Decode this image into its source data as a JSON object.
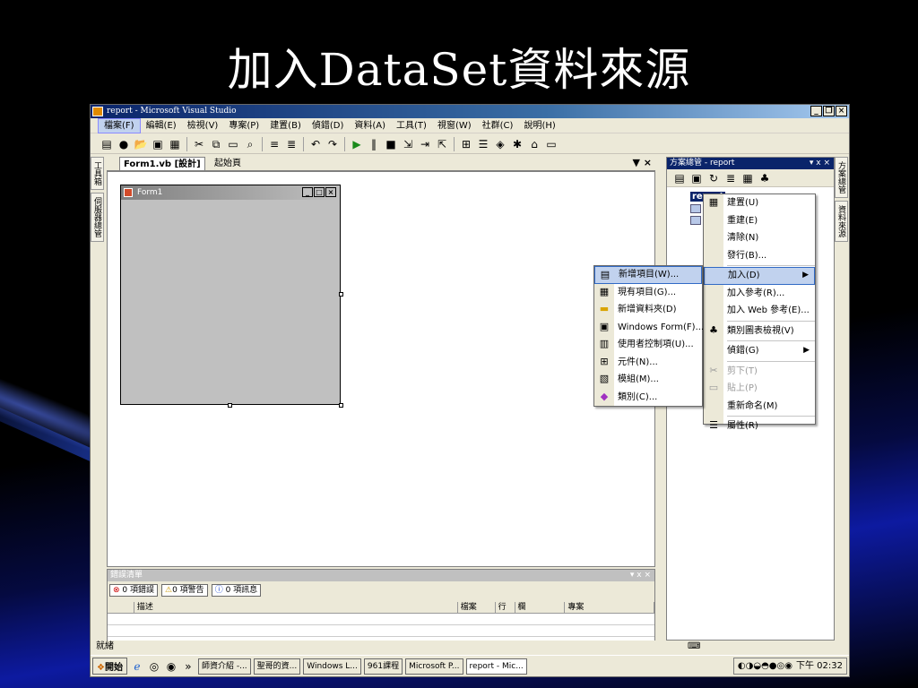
{
  "slide": {
    "title": "加入DataSet資料來源"
  },
  "window": {
    "title": "report - Microsoft Visual Studio",
    "app_icon_label": "report"
  },
  "menubar": [
    "檔案(F)",
    "編輯(E)",
    "檢視(V)",
    "專案(P)",
    "建置(B)",
    "偵錯(D)",
    "資料(A)",
    "工具(T)",
    "視窗(W)",
    "社群(C)",
    "說明(H)"
  ],
  "left_dock": [
    "工具箱",
    "伺服器總管"
  ],
  "right_dock": [
    "方案總管",
    "資料來源"
  ],
  "document": {
    "tabs": [
      "Form1.vb [設計]",
      "起始頁"
    ],
    "close": "▼ ×"
  },
  "form": {
    "title": "Form1"
  },
  "error_list": {
    "title": "錯誤清單",
    "title_ctrls": "▾ ⅹ ×",
    "tabs": [
      "0 項錯誤",
      "0 項警告",
      "0 項訊息"
    ],
    "columns": [
      "描述",
      "檔案",
      "行",
      "欄",
      "專案"
    ]
  },
  "solution_explorer": {
    "title": "方案總管 - report",
    "title_ctrls": "▾ ⅹ ×",
    "root": "report"
  },
  "project_menu": [
    {
      "label": "建置(U)",
      "icon": "build-icon"
    },
    {
      "label": "重建(E)",
      "icon": ""
    },
    {
      "label": "清除(N)",
      "icon": ""
    },
    {
      "label": "發行(B)...",
      "icon": ""
    },
    {
      "label": "加入(D)",
      "icon": "",
      "highlight": true,
      "submenu": true
    },
    {
      "label": "加入參考(R)...",
      "icon": ""
    },
    {
      "label": "加入 Web 參考(E)...",
      "icon": ""
    },
    {
      "label": "類別圖表檢視(V)",
      "icon": "class-diagram-icon"
    },
    {
      "label": "偵錯(G)",
      "icon": "",
      "submenu": true
    },
    {
      "label": "剪下(T)",
      "icon": "cut-icon",
      "disabled": true
    },
    {
      "label": "貼上(P)",
      "icon": "paste-icon",
      "disabled": true
    },
    {
      "label": "重新命名(M)",
      "icon": ""
    },
    {
      "label": "屬性(R)",
      "icon": "properties-icon"
    }
  ],
  "add_submenu": [
    {
      "label": "新增項目(W)...",
      "icon": "new-item-icon",
      "highlight": true
    },
    {
      "label": "現有項目(G)...",
      "icon": "existing-item-icon"
    },
    {
      "label": "新增資料夾(D)",
      "icon": "folder-icon"
    },
    {
      "label": "Windows Form(F)...",
      "icon": "windows-form-icon"
    },
    {
      "label": "使用者控制項(U)...",
      "icon": "user-control-icon"
    },
    {
      "label": "元件(N)...",
      "icon": "component-icon"
    },
    {
      "label": "模組(M)...",
      "icon": "module-icon"
    },
    {
      "label": "類別(C)...",
      "icon": "class-icon"
    }
  ],
  "status": "就緒",
  "taskbar": {
    "start": "開始",
    "buttons": [
      "師資介紹 -...",
      "聖哥的資...",
      "Windows L...",
      "961課程",
      "Microsoft P...",
      "report - Mic..."
    ],
    "clock": "下午 02:32"
  }
}
